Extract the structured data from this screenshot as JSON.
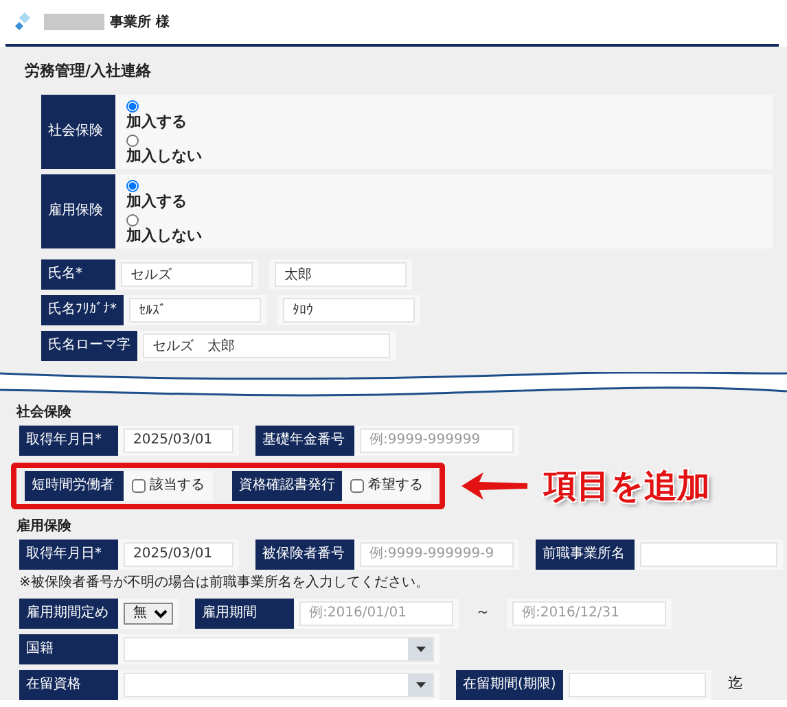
{
  "header": {
    "title": "事業所 様"
  },
  "section_title": "労務管理/入社連絡",
  "enrollment": [
    {
      "label": "社会保険",
      "options": [
        {
          "label": "加入する",
          "selected": true
        },
        {
          "label": "加入しない",
          "selected": false
        }
      ]
    },
    {
      "label": "雇用保険",
      "options": [
        {
          "label": "加入する",
          "selected": true
        },
        {
          "label": "加入しない",
          "selected": false
        }
      ]
    }
  ],
  "name_rows": [
    {
      "label": "氏名*",
      "kind": "pair",
      "values": [
        "セルズ",
        "太郎"
      ]
    },
    {
      "label": "氏名ﾌﾘｶﾞﾅ*",
      "kind": "pair",
      "values": [
        "ｾﾙｽﾞ",
        "ﾀﾛｳ"
      ]
    },
    {
      "label": "氏名ローマ字",
      "kind": "single",
      "values": [
        "セルズ　太郎"
      ]
    }
  ],
  "social_insurance": {
    "heading": "社会保険",
    "rows": [
      {
        "highlighted": false,
        "items": [
          {
            "kind": "input",
            "label": "取得年月日*",
            "value": "2025/03/01"
          },
          {
            "kind": "input",
            "label": "基礎年金番号",
            "placeholder": "例:9999-999999"
          }
        ]
      },
      {
        "highlighted": true,
        "items": [
          {
            "kind": "checkbox",
            "label": "短時間労働者",
            "text": "該当する",
            "checked": false
          },
          {
            "kind": "checkbox",
            "label": "資格確認書発行",
            "text": "希望する",
            "checked": false
          }
        ]
      }
    ]
  },
  "annotation": {
    "text": "項目を追加"
  },
  "employment_insurance": {
    "heading": "雇用保険",
    "rows": [
      {
        "highlighted": false,
        "items": [
          {
            "kind": "input",
            "label": "取得年月日*",
            "value": "2025/03/01"
          },
          {
            "kind": "input",
            "label": "被保険者番号",
            "placeholder": "例:9999-999999-9"
          },
          {
            "kind": "input",
            "label": "前職事業所名"
          }
        ]
      },
      {
        "highlighted": false,
        "items": [
          {
            "kind": "note",
            "text": "※被保険者番号が不明の場合は前職事業所名を入力してください。"
          }
        ]
      },
      {
        "highlighted": false,
        "items": [
          {
            "kind": "select",
            "label": "雇用期間定め",
            "value": "無"
          },
          {
            "kind": "input",
            "label": "雇用期間",
            "placeholder": "例:2016/01/01"
          },
          {
            "kind": "text",
            "text": "～"
          },
          {
            "kind": "input",
            "placeholder": "例:2016/12/31"
          }
        ]
      },
      {
        "highlighted": false,
        "items": [
          {
            "kind": "dropdown",
            "label": "国籍"
          }
        ]
      },
      {
        "highlighted": false,
        "items": [
          {
            "kind": "dropdown",
            "label": "在留資格"
          },
          {
            "kind": "input",
            "label": "在留期間(期限)"
          },
          {
            "kind": "text",
            "text": "迄"
          }
        ]
      }
    ]
  }
}
